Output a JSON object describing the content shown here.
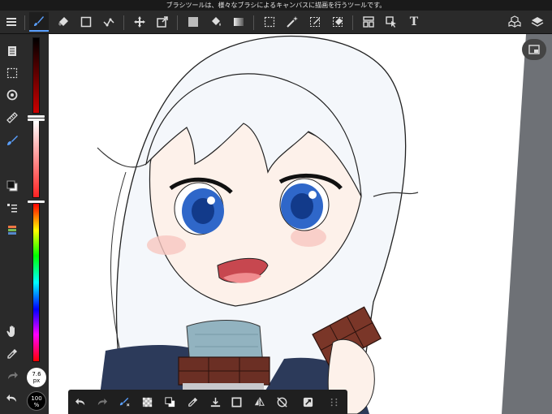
{
  "tooltip": "ブラシツールは、様々なブラシによるキャンバスに描画を行うツールです。",
  "brush": {
    "size_value": "7.6",
    "size_unit": "px"
  },
  "opacity": {
    "value": "100",
    "unit": "%"
  },
  "colors": {
    "accent": "#5aa0ff",
    "toolbar_bg": "#2a2a2a",
    "canvas_bg": "#ffffff",
    "side_gray": "#6e7176"
  },
  "icons": {
    "top": [
      "menu-icon",
      "brush-icon",
      "eraser-icon",
      "rectangle-icon",
      "pen-path-icon",
      "move-icon",
      "transform-icon",
      "fill-color-icon",
      "bucket-icon",
      "gradient-icon",
      "selection-icon",
      "magic-wand-icon",
      "select-pen-icon",
      "select-eraser-icon",
      "panel-icon",
      "select-cursor-icon",
      "text-icon",
      "material-icon",
      "layers-icon"
    ],
    "left": [
      "pages-icon",
      "marquee-icon",
      "rotate-icon",
      "ruler-icon",
      "brush-preset-icon",
      "color-swatch-icon",
      "layer-list-icon",
      "palette-icon",
      "hand-icon",
      "eyedropper-icon",
      "redo-icon",
      "undo-icon"
    ],
    "bottom": [
      "undo-icon",
      "redo-icon",
      "brush-swap-icon",
      "transparent-icon",
      "color-swap-icon",
      "eyedropper-icon",
      "save-icon",
      "border-icon",
      "flip-icon",
      "rotate-reset-icon",
      "snap-icon",
      "grid-icon"
    ]
  }
}
